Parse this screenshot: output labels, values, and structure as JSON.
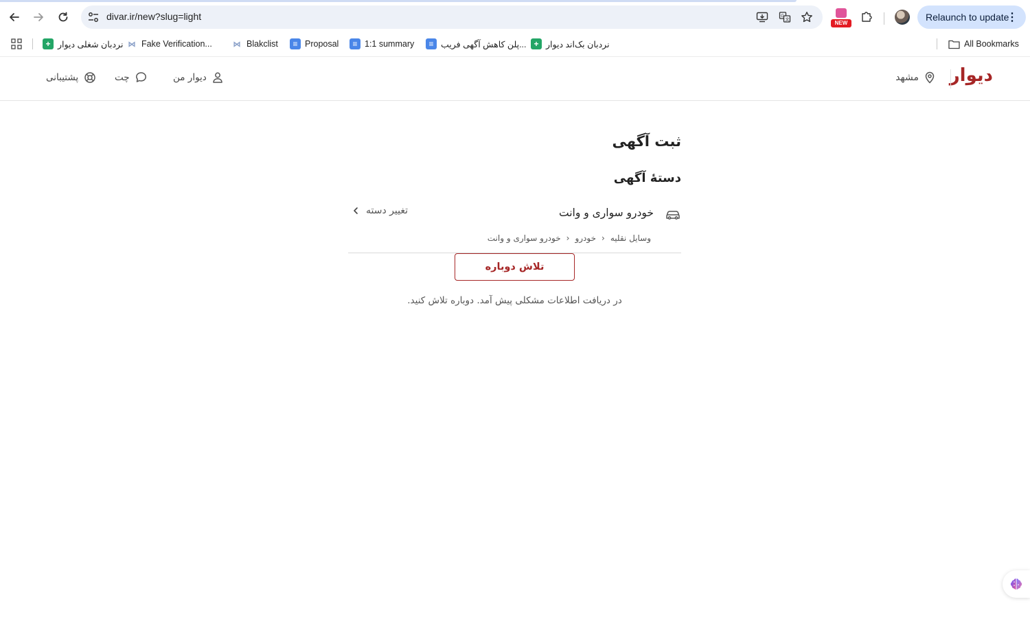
{
  "browser": {
    "url": "divar.ir/new?slug=light",
    "relaunch_label": "Relaunch to update",
    "new_badge": "NEW",
    "bookmarks": [
      {
        "label": "نردبان شغلی دیوار",
        "icon": "sheets-icon"
      },
      {
        "label": "Fake Verification...",
        "icon": "grid-icon"
      },
      {
        "label": "Blakclist",
        "icon": "grid-icon"
      },
      {
        "label": "Proposal",
        "icon": "docs-icon"
      },
      {
        "label": "1:1 summary",
        "icon": "docs-icon"
      },
      {
        "label": "پلن کاهش آگهی فریب...",
        "icon": "docs-icon"
      },
      {
        "label": "نردبان بک‌اند دیوار",
        "icon": "sheets-icon"
      }
    ],
    "all_bookmarks": "All Bookmarks"
  },
  "header": {
    "logo": "دیوار",
    "city": "مشهد",
    "my_divar": "دیوار من",
    "chat": "چت",
    "support": "پشتیبانی"
  },
  "page": {
    "title": "ثبت آگهی",
    "section_title": "دستهٔ آگهی",
    "category_name": "خودرو سواری و وانت",
    "change_category": "تغییر دسته",
    "breadcrumb": [
      "وسایل نقلیه",
      "خودرو",
      "خودرو سواری و وانت"
    ],
    "retry_label": "تلاش دوباره",
    "error_message": "در دریافت اطلاعات مشکلی پیش آمد. دوباره تلاش کنید."
  },
  "colors": {
    "brand": "#a62626",
    "relaunch_bg": "#d3e3fd",
    "omnibox_bg": "#edf1f8"
  }
}
